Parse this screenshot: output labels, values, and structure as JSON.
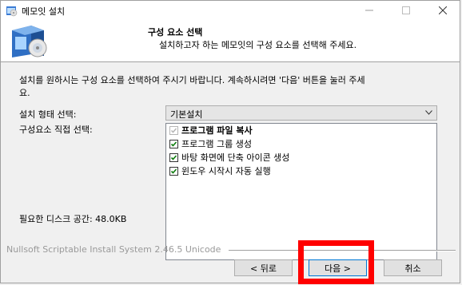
{
  "window": {
    "title": "메모잇 설치"
  },
  "header": {
    "title": "구성 요소 선택",
    "subtitle": "설치하고자 하는 메모잇의 구성 요소를 선택해 주세요."
  },
  "instruction": "설치를 원하시는 구성 요소를 선택하여 주시기 바랍니다. 계속하시려면 '다음' 버튼을 눌러 주세\n요.",
  "labels": {
    "install_type": "설치 형태 선택:",
    "component_select": "구성요소 직접 선택:",
    "disk_space": "필요한 디스크 공간: 48.0KB"
  },
  "install_type": {
    "selected": "기본설치"
  },
  "components": [
    {
      "label": "프로그램 파일 복사",
      "checked": true,
      "disabled": true
    },
    {
      "label": "프로그램 그룹 생성",
      "checked": true,
      "disabled": false
    },
    {
      "label": "바탕 화면에 단축 아이콘 생성",
      "checked": true,
      "disabled": false
    },
    {
      "label": "윈도우 시작시 자동 실행",
      "checked": true,
      "disabled": false
    }
  ],
  "branding": "Nullsoft Scriptable Install System 2.46.5 Unicode",
  "buttons": {
    "back": "< 뒤로",
    "next": "다음 >",
    "cancel": "취소"
  },
  "colors": {
    "highlight": "#ff0000",
    "checkmark": "#0a7a0a",
    "focus_border": "#0078d7"
  }
}
